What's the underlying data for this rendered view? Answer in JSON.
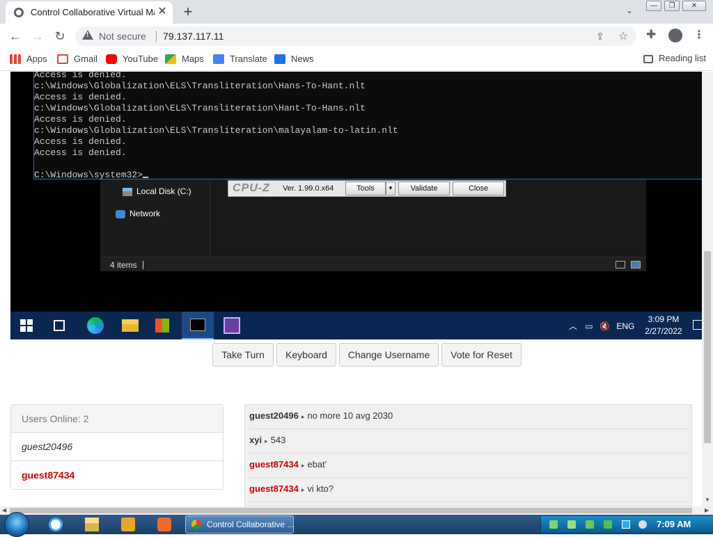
{
  "browser": {
    "tab_title": "Control Collaborative Virtual Mac",
    "new_tab": "+",
    "security_label": "Not secure",
    "url": "79.137.117.11",
    "window_controls": [
      "—",
      "❐",
      "✕"
    ]
  },
  "bookmarks": {
    "items": [
      {
        "label": "Apps",
        "icon": "apps-grid-icon",
        "color": "#4285f4"
      },
      {
        "label": "Gmail",
        "icon": "gmail-icon",
        "color": "#ea4335"
      },
      {
        "label": "YouTube",
        "icon": "youtube-icon",
        "color": "#ff0000"
      },
      {
        "label": "Maps",
        "icon": "maps-icon",
        "color": "#34a853"
      },
      {
        "label": "Translate",
        "icon": "translate-icon",
        "color": "#4285f4"
      },
      {
        "label": "News",
        "icon": "news-icon",
        "color": "#1a73e8"
      }
    ],
    "reading_list": "Reading list"
  },
  "vm": {
    "console_lines": [
      "Access is denied.",
      "c:\\Windows\\Globalization\\ELS\\Transliteration\\Hans-To-Hant.nlt",
      "Access is denied.",
      "c:\\Windows\\Globalization\\ELS\\Transliteration\\Hant-To-Hans.nlt",
      "Access is denied.",
      "c:\\Windows\\Globalization\\ELS\\Transliteration\\malayalam-to-latin.nlt",
      "Access is denied.",
      "Access is denied.",
      "",
      "C:\\Windows\\system32>"
    ],
    "explorer": {
      "local_disk": "Local Disk (C:)",
      "network": "Network",
      "item_count": "4 items"
    },
    "cpuz": {
      "logo": "CPU-Z",
      "version": "Ver. 1.99.0.x64",
      "tools": "Tools",
      "validate": "Validate",
      "close": "Close"
    },
    "taskbar": {
      "lang": "ENG",
      "time": "3:09 PM",
      "date": "2/27/2022"
    }
  },
  "controls": {
    "take_turn": "Take Turn",
    "keyboard": "Keyboard",
    "change_username": "Change Username",
    "vote_reset": "Vote for Reset"
  },
  "users": {
    "header": "Users Online: 2",
    "list": [
      {
        "name": "guest20496",
        "color": "#333333"
      },
      {
        "name": "guest87434",
        "color": "#cc0000"
      }
    ]
  },
  "chat": {
    "messages": [
      {
        "user": "guest20496",
        "text": "no more 10 avg 2030",
        "color": "#333333"
      },
      {
        "user": "xyi",
        "text": "543",
        "color": "#333333"
      },
      {
        "user": "guest87434",
        "text": "ebat'",
        "color": "#cc0000"
      },
      {
        "user": "guest87434",
        "text": "vi kto?",
        "color": "#cc0000"
      }
    ]
  },
  "host_taskbar": {
    "chrome_button": "Control Collaborative ...",
    "time": "7:09 AM"
  }
}
